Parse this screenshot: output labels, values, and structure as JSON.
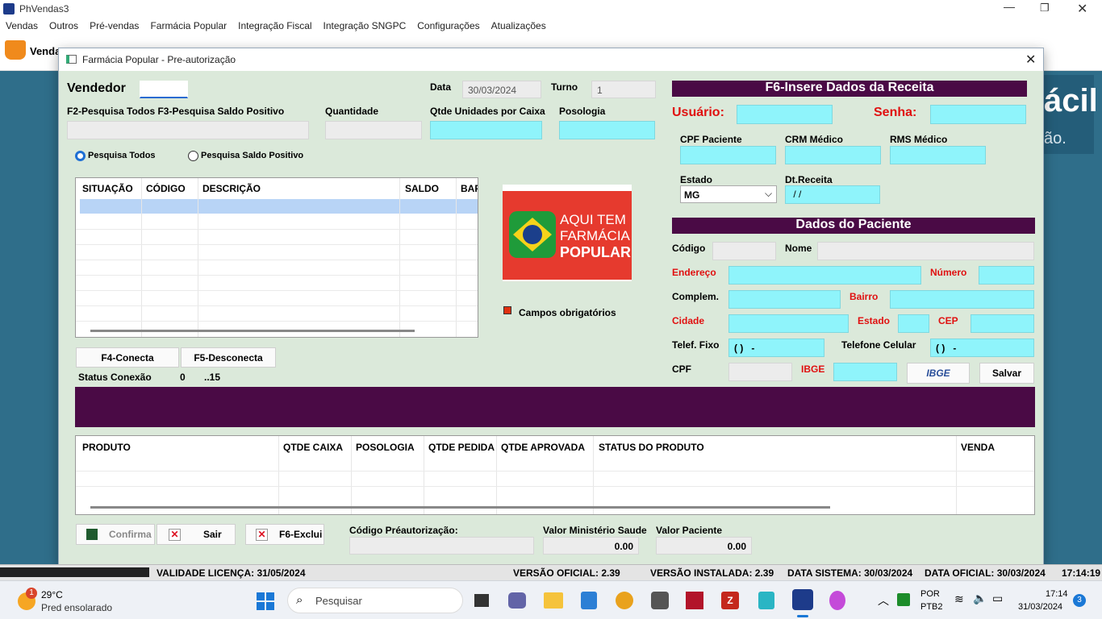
{
  "app": {
    "title": "PhVendas3"
  },
  "menu": [
    "Vendas",
    "Outros",
    "Pré-vendas",
    "Farmácia Popular",
    "Integração Fiscal",
    "Integração SNGPC",
    "Configurações",
    "Atualizações"
  ],
  "toolbar": {
    "vendas_label": "Venda"
  },
  "banner": {
    "text1": "ácil",
    "text2": "ão."
  },
  "dialog": {
    "title": "Farmácia Popular - Pre-autorização",
    "vendedor_label": "Vendedor",
    "data_label": "Data",
    "data_value": "30/03/2024",
    "turno_label": "Turno",
    "turno_value": "1",
    "search_hint": "F2-Pesquisa Todos F3-Pesquisa Saldo Positivo",
    "quantidade_label": "Quantidade",
    "qtde_caixa_label": "Qtde Unidades por Caixa",
    "posologia_label": "Posologia",
    "radio_todos": "Pesquisa Todos",
    "radio_saldo": "Pesquisa Saldo Positivo",
    "table_headers": [
      "SITUAÇÃO",
      "CÓDIGO",
      "DESCRIÇÃO",
      "SALDO",
      "BAF"
    ],
    "logo": {
      "line1": "AQUI TEM",
      "line2": "FARMÁCIA",
      "line3": "POPULAR"
    },
    "campos_obrigatorios": "Campos obrigatórios",
    "btn_conecta": "F4-Conecta",
    "btn_desconecta": "F5-Desconecta",
    "status_conexao_label": "Status Conexão",
    "status_conexao_value": "0",
    "status_conexao_extra": "..15",
    "receita": {
      "title": "F6-Insere Dados da Receita",
      "usuario_label": "Usuário:",
      "senha_label": "Senha:",
      "cpf_label": "CPF Paciente",
      "crm_label": "CRM Médico",
      "rms_label": "RMS Médico",
      "estado_label": "Estado",
      "estado_value": "MG",
      "dt_receita_label": "Dt.Receita",
      "dt_receita_value": " / /"
    },
    "paciente": {
      "title": "Dados do Paciente",
      "codigo_label": "Código",
      "nome_label": "Nome",
      "endereco_label": "Endereço",
      "numero_label": "Número",
      "complem_label": "Complem.",
      "bairro_label": "Bairro",
      "cidade_label": "Cidade",
      "estado_label": "Estado",
      "cep_label": "CEP",
      "telfixo_label": "Telef. Fixo",
      "telfixo_value": "( )   -",
      "celular_label": "Telefone Celular",
      "celular_value": "( )   -",
      "cpf_label": "CPF",
      "ibge_label": "IBGE",
      "ibge_button": "IBGE",
      "salvar_button": "Salvar"
    },
    "products_headers": [
      "PRODUTO",
      "QTDE CAIXA",
      "POSOLOGIA",
      "QTDE PEDIDA",
      "QTDE APROVADA",
      "STATUS DO PRODUTO",
      "VENDA"
    ],
    "btn_confirma": "Confirma",
    "btn_sair": "Sair",
    "btn_exclui": "F6-Exclui",
    "codigo_preaut_label": "Código Préautorização:",
    "valor_ministerio_label": "Valor Ministério Saude",
    "valor_ministerio_value": "0.00",
    "valor_paciente_label": "Valor Paciente",
    "valor_paciente_value": "0.00"
  },
  "statusbar": {
    "validade": "VALIDADE LICENÇA: 31/05/2024",
    "versao_oficial": "VERSÃO OFICIAL: 2.39",
    "versao_instalada": "VERSÃO INSTALADA: 2.39",
    "data_sistema": "DATA SISTEMA: 30/03/2024",
    "data_oficial": "DATA OFICIAL: 30/03/2024",
    "time": "17:14:19"
  },
  "taskbar": {
    "weather_temp": "29°C",
    "weather_desc": "Pred ensolarado",
    "weather_badge": "1",
    "search_placeholder": "Pesquisar",
    "lang1": "POR",
    "lang2": "PTB2",
    "clock_time": "17:14",
    "clock_date": "31/03/2024",
    "notif_count": "3"
  }
}
